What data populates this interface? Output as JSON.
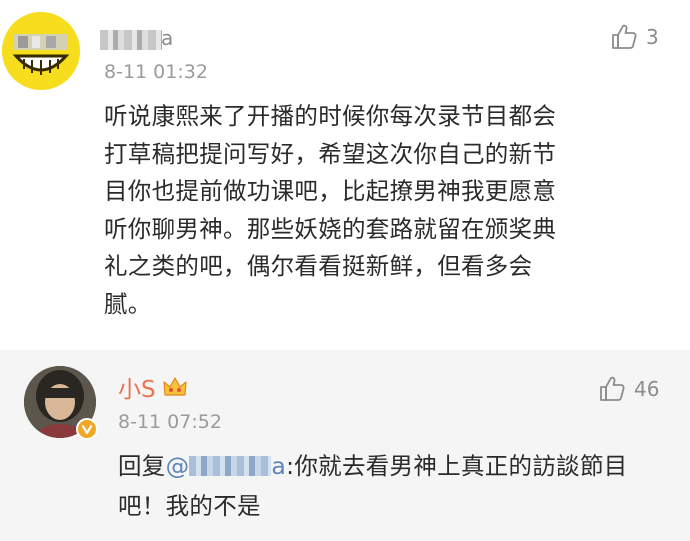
{
  "comments": [
    {
      "username_suffix": "a",
      "timestamp": "8-11 01:32",
      "likes": "3",
      "text_lines": [
        "听说康熙来了开播的时候你每次录节目都会",
        "打草稿把提问写好，希望这次你自己的新节",
        "目你也提前做功课吧，比起撩男神我更愿意",
        "听你聊男神。那些妖娆的套路就留在颁奖典",
        "礼之类的吧，偶尔看看挺新鲜，但看多会",
        "腻。"
      ]
    },
    {
      "username": "小S",
      "timestamp": "8-11 07:52",
      "likes": "46",
      "reply_prefix": "回复",
      "mention_at": "@",
      "mention_suffix": "a",
      "reply_line1_rest": ":你就去看男神上真正的訪談節目",
      "reply_line2": "吧！我的不是"
    }
  ],
  "colors": {
    "author_name": "#eb7350",
    "mention": "#5b84b7",
    "meta_gray": "#9b9b9b",
    "text": "#2b2b2b",
    "reply_background": "#f5f5f5"
  },
  "icons": {
    "like": "thumbs-up-icon",
    "crown": "crown-badge-icon",
    "verified": "verified-v-badge-icon"
  }
}
